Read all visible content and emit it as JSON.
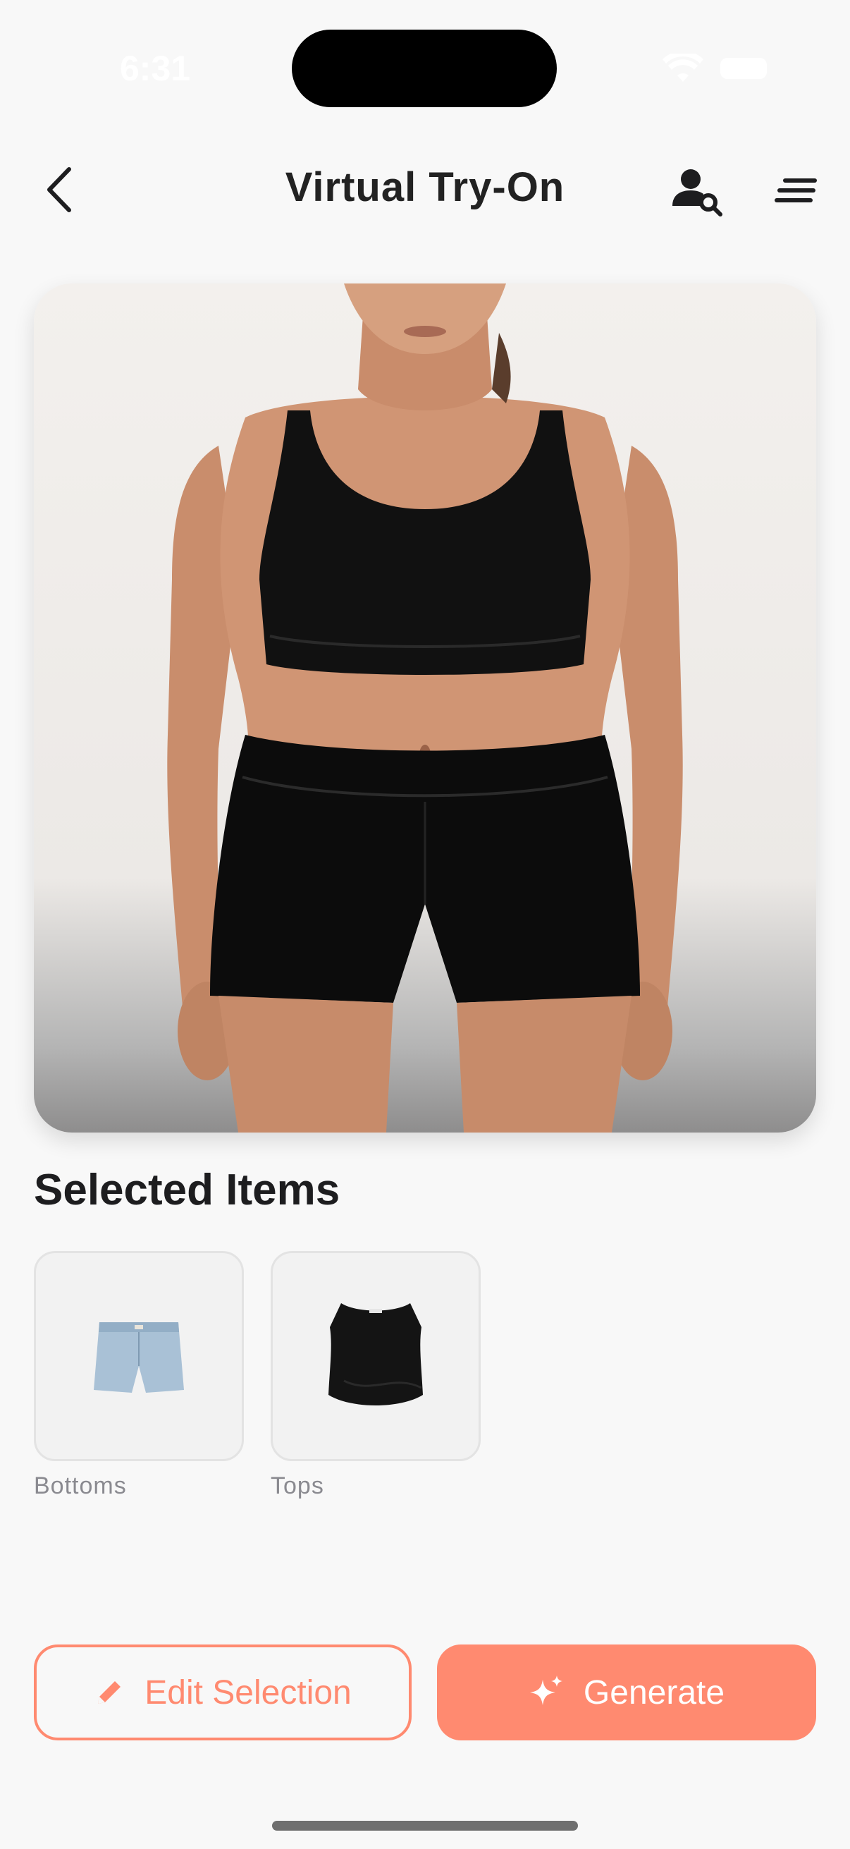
{
  "status": {
    "time": "6:31"
  },
  "header": {
    "title": "Virtual Try-On"
  },
  "icons": {
    "back": "chevron-left-icon",
    "profile_search": "person-search-icon",
    "menu": "sort-lines-icon",
    "edit": "pencil-icon",
    "generate": "sparkles-icon"
  },
  "section": {
    "title": "Selected Items"
  },
  "items": [
    {
      "label": "Bottoms"
    },
    {
      "label": "Tops"
    }
  ],
  "actions": {
    "edit_label": "Edit Selection",
    "generate_label": "Generate"
  },
  "colors": {
    "accent": "#ff8a70",
    "title": "#222222",
    "caption": "#8a8a90"
  }
}
